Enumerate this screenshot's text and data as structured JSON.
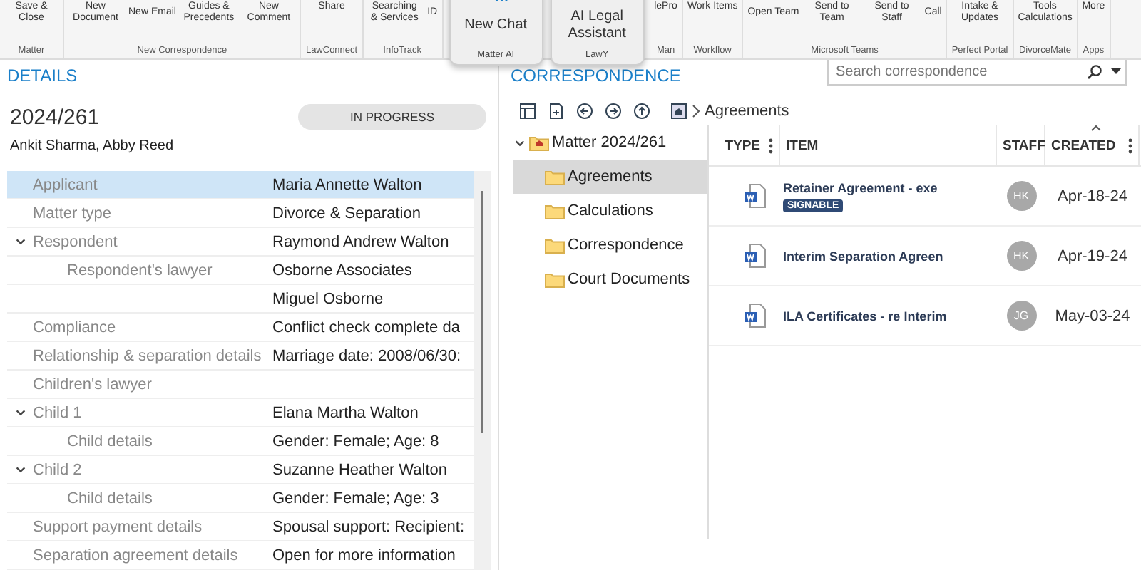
{
  "ribbon": {
    "groups": [
      {
        "label": "Matter",
        "buttons": [
          "Save & Close"
        ]
      },
      {
        "label": "New Correspondence",
        "buttons": [
          "New Document",
          "New Email",
          "Guides & Precedents",
          "New Comment"
        ]
      },
      {
        "label": "LawConnect",
        "buttons": [
          "Share"
        ]
      },
      {
        "label": "InfoTrack",
        "buttons": [
          "Searching & Services",
          "ID"
        ]
      },
      {
        "label": "Man",
        "buttons": [
          "lePro"
        ]
      },
      {
        "label": "Workflow",
        "buttons": [
          "Work Items"
        ]
      },
      {
        "label": "Microsoft Teams",
        "buttons": [
          "Open Team",
          "Send to Team",
          "Send to Staff",
          "Call"
        ]
      },
      {
        "label": "Perfect Portal",
        "buttons": [
          "Intake & Updates"
        ]
      },
      {
        "label": "DivorceMate",
        "buttons": [
          "Tools Calculations"
        ]
      },
      {
        "label": "Apps",
        "buttons": [
          "More"
        ]
      }
    ],
    "popups": [
      {
        "button": "New Chat",
        "label": "Matter AI"
      },
      {
        "button": "AI Legal Assistant",
        "label": "LawY"
      }
    ]
  },
  "details": {
    "heading": "DETAILS",
    "matter_number": "2024/261",
    "status": "IN PROGRESS",
    "staff": "Ankit Sharma, Abby Reed",
    "rows": [
      {
        "label": "Applicant",
        "value": "Maria Annette Walton",
        "selected": true
      },
      {
        "label": "Matter type",
        "value": "Divorce & Separation",
        "selected": false
      },
      {
        "label": "Respondent",
        "value": "Raymond Andrew Walton",
        "selected": false,
        "expanded": true,
        "children": [
          {
            "label": "Respondent's lawyer",
            "value": "Osborne Associates",
            "selected": false
          },
          {
            "value": "Miguel Osborne",
            "selected": false
          }
        ]
      },
      {
        "label": "Compliance",
        "value": "Conflict check complete da",
        "selected": false
      },
      {
        "label": "Relationship & separation details",
        "value": "Marriage date: 2008/06/30:",
        "selected": false
      },
      {
        "label": "Children's lawyer",
        "selected": false
      },
      {
        "label": "Child 1",
        "value": "Elana Martha Walton",
        "selected": false,
        "expanded": true,
        "children": [
          {
            "label": "Child details",
            "value": "Gender: Female; Age: 8",
            "selected": false
          }
        ]
      },
      {
        "label": "Child 2",
        "value": "Suzanne Heather Walton",
        "selected": false,
        "expanded": true,
        "children": [
          {
            "label": "Child details",
            "value": "Gender: Female; Age: 3",
            "selected": false
          }
        ]
      },
      {
        "label": "Support payment details",
        "value": "Spousal support: Recipient:",
        "selected": false
      },
      {
        "label": "Separation agreement details",
        "value": "Open for more information",
        "selected": false
      }
    ]
  },
  "correspondence": {
    "heading": "CORRESPONDENCE",
    "search": {
      "placeholder": "Search correspondence"
    },
    "breadcrumb": "Agreements",
    "tree": {
      "label": "Matter 2024/261",
      "expanded": true,
      "selected": false,
      "children": [
        {
          "label": "Agreements",
          "selected": true
        },
        {
          "label": "Calculations",
          "selected": false
        },
        {
          "label": "Correspondence",
          "selected": false
        },
        {
          "label": "Court Documents",
          "selected": false
        }
      ]
    },
    "columns": [
      "TYPE",
      "ITEM",
      "STAFF",
      "CREATED"
    ],
    "rows": [
      {
        "item": "Retainer Agreement - exe",
        "badge": "SIGNABLE",
        "staff": "HK",
        "created": "Apr-18-24"
      },
      {
        "item": "Interim Separation Agreen",
        "staff": "HK",
        "created": "Apr-19-24"
      },
      {
        "item": "ILA Certificates - re Interim",
        "staff": "JG",
        "created": "May-03-24"
      }
    ]
  }
}
